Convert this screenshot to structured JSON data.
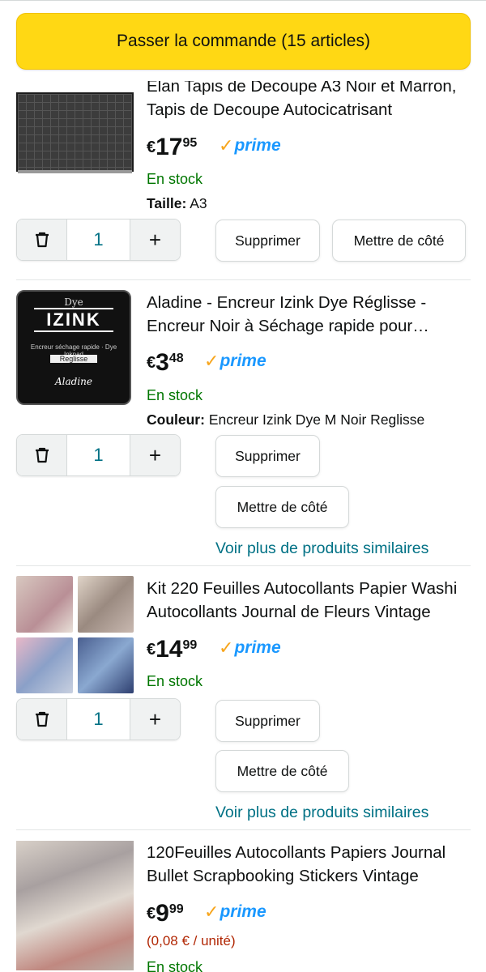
{
  "checkout": {
    "label": "Passer la commande",
    "count": "(15 articles)"
  },
  "items": [
    {
      "title": "Elan Tapis de Decoupe A3 Noir et Marron, Tapis de Decoupe Autocicatrisant",
      "price": {
        "currency": "€",
        "whole": "17",
        "fraction": "95"
      },
      "prime": "prime",
      "stock": "En stock",
      "attr_label": "Taille:",
      "attr_value": "A3",
      "qty": "1",
      "delete": "Supprimer",
      "save": "Mettre de côté"
    },
    {
      "title": "Aladine - Encreur Izink Dye Réglisse - Encreur Noir à Séchage rapide pour Tampons",
      "price": {
        "currency": "€",
        "whole": "3",
        "fraction": "48"
      },
      "prime": "prime",
      "stock": "En stock",
      "attr_label": "Couleur:",
      "attr_value": "Encreur Izink Dye M Noir Reglisse",
      "qty": "1",
      "delete": "Supprimer",
      "save": "Mettre de côté",
      "more": "Voir plus de produits similaires",
      "thumb_text": {
        "brand": "Dye",
        "name": "IZINK",
        "sub": "Encreur séchage rapide · Dye Inkpad",
        "color": "Reglisse",
        "logo": "Aladine"
      }
    },
    {
      "title": "Kit 220 Feuilles Autocollants Papier Washi Autocollants Journal de Fleurs Vintage",
      "price": {
        "currency": "€",
        "whole": "14",
        "fraction": "99"
      },
      "prime": "prime",
      "stock": "En stock",
      "qty": "1",
      "delete": "Supprimer",
      "save": "Mettre de côté",
      "more": "Voir plus de produits similaires"
    },
    {
      "title": "120Feuilles Autocollants Papiers Journal Bullet Scrapbooking Stickers Vintage",
      "price": {
        "currency": "€",
        "whole": "9",
        "fraction": "99"
      },
      "prime": "prime",
      "unit_price": "(0,08 € / unité)",
      "stock": "En stock"
    }
  ],
  "colors": {
    "checkout": "#ffd814",
    "stock": "#007600",
    "link": "#007185",
    "prime_blue": "#1a98ff",
    "prime_check": "#f7a51c",
    "unit_price": "#b12704"
  }
}
